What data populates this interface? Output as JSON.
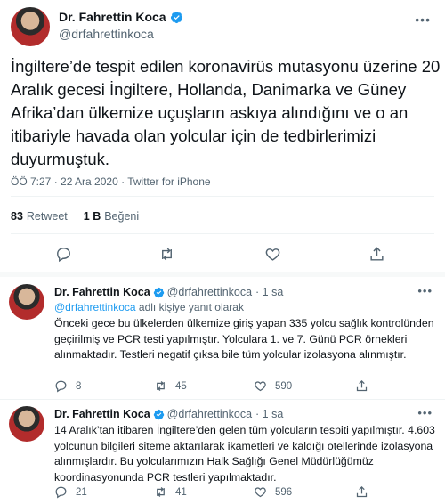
{
  "main": {
    "display_name": "Dr. Fahrettin Koca",
    "handle": "@drfahrettinkoca",
    "more_icon": "more-dots-icon",
    "text": "İngiltere’de tespit edilen koronavirüs mutasyonu üzerine 20 Aralık gecesi İngiltere, Hollanda, Danimarka ve Güney Afrika’dan ülkemize uçuşların askıya alındığını ve o an itibariyle havada olan yolcular için de tedbirlerimizi duyurmuştuk.",
    "meta": "ÖÖ 7:27 · 22 Ara 2020 · Twitter for iPhone",
    "retweet_count": "83",
    "retweet_label": "Retweet",
    "like_count": "1 B",
    "like_label": "Beğeni"
  },
  "replies": [
    {
      "name": "Dr. Fahrettin Koca",
      "handle": "@drfahrettinkoca",
      "time": "· 1 sa",
      "context_link": "@drfahrettinkoca",
      "context_text": " adlı kişiye yanıt olarak",
      "text": "Önceki gece bu ülkelerden ülkemize giriş yapan 335 yolcu sağlık kontrolünden geçirilmiş ve PCR testi yapılmıştır. Yolculara 1. ve 7. Günü PCR örnekleri alınmaktadır. Testleri negatif çıksa bile tüm yolcular izolasyona alınmıştır.",
      "reply_count": "8",
      "retweet_count": "45",
      "like_count": "590"
    },
    {
      "name": "Dr. Fahrettin Koca",
      "handle": "@drfahrettinkoca",
      "time": "· 1 sa",
      "text": "14 Aralık’tan itibaren İngiltere’den gelen tüm yolcuların tespiti yapılmıştır. 4.603 yolcunun bilgileri siteme aktarılarak ikametleri ve kaldığı otellerinde izolasyona alınmışlardır. Bu yolcularımızın Halk Sağlığı Genel Müdürlüğümüz koordinasyonunda PCR testleri yapılmaktadır.",
      "reply_count": "21",
      "retweet_count": "41",
      "like_count": "596"
    }
  ],
  "colors": {
    "accent": "#1d9bf0",
    "secondary_text": "#536471",
    "divider": "#eff3f4"
  }
}
